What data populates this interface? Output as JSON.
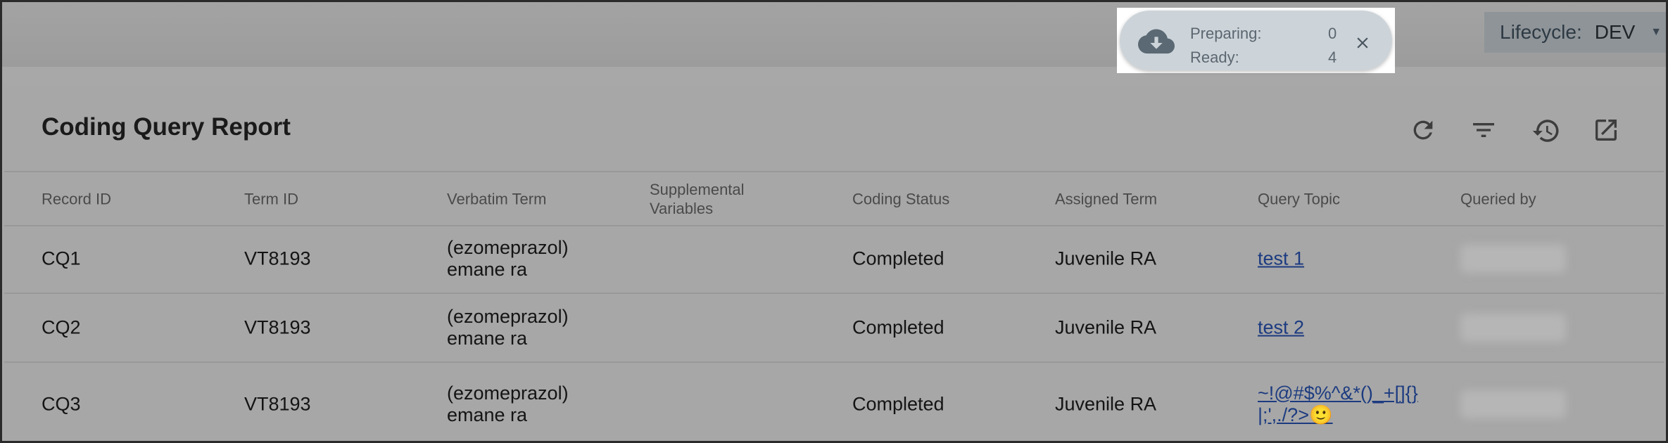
{
  "lifecycle": {
    "label": "Lifecycle:",
    "value": "DEV"
  },
  "download_toast": {
    "preparing_label": "Preparing:",
    "preparing_count": "0",
    "ready_label": "Ready:",
    "ready_count": "4"
  },
  "report": {
    "title": "Coding Query Report",
    "toolbar": [
      "refresh-icon",
      "filter-icon",
      "history-icon",
      "open-external-icon"
    ],
    "columns": {
      "record_id": "Record ID",
      "term_id": "Term ID",
      "verbatim_term": "Verbatim Term",
      "supplemental_variables": "Supplemental Variables",
      "coding_status": "Coding Status",
      "assigned_term": "Assigned Term",
      "query_topic": "Query Topic",
      "queried_by": "Queried by"
    },
    "rows": [
      {
        "record_id": "CQ1",
        "term_id": "VT8193",
        "verbatim_term": "(ezomeprazol) emane ra",
        "supplemental_variables": "",
        "coding_status": "Completed",
        "assigned_term": "Juvenile RA",
        "query_topic": "test 1"
      },
      {
        "record_id": "CQ2",
        "term_id": "VT8193",
        "verbatim_term": "(ezomeprazol) emane ra",
        "supplemental_variables": "",
        "coding_status": "Completed",
        "assigned_term": "Juvenile RA",
        "query_topic": "test 2"
      },
      {
        "record_id": "CQ3",
        "term_id": "VT8193",
        "verbatim_term": "(ezomeprazol) emane ra",
        "supplemental_variables": "",
        "coding_status": "Completed",
        "assigned_term": "Juvenile RA",
        "query_topic": "~!@#$%^&*()_+[]{}|;',./?>🙂"
      }
    ]
  },
  "colors": {
    "link": "#1c3b80",
    "overlay": "#a8a8a8",
    "toast_bg": "#cdd4d9",
    "lifecycle_bg": "#8f9498"
  }
}
